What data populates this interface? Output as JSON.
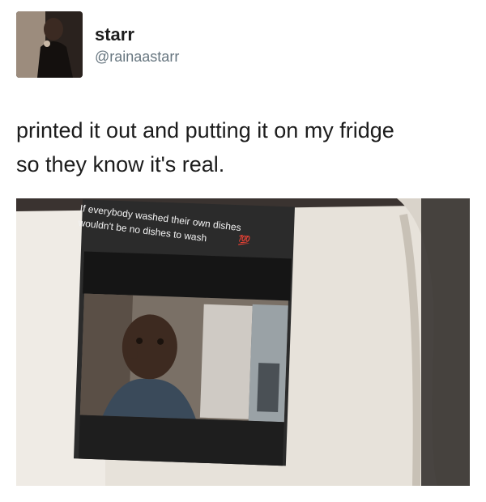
{
  "tweet": {
    "display_name": "starr",
    "handle": "@rainaastarr",
    "text_line1": "printed it out and putting it on my fridge",
    "text_line2": "so they know it's real."
  },
  "photo": {
    "caption_line1": "If everybody washed their own dishes",
    "caption_line2": "wouldn't be no dishes to wash",
    "caption_emoji": "💯"
  },
  "colors": {
    "text": "#1c1c1c",
    "handle": "#66757f",
    "fridge": "#e9e4dd",
    "poster": "#2b2b2b"
  }
}
